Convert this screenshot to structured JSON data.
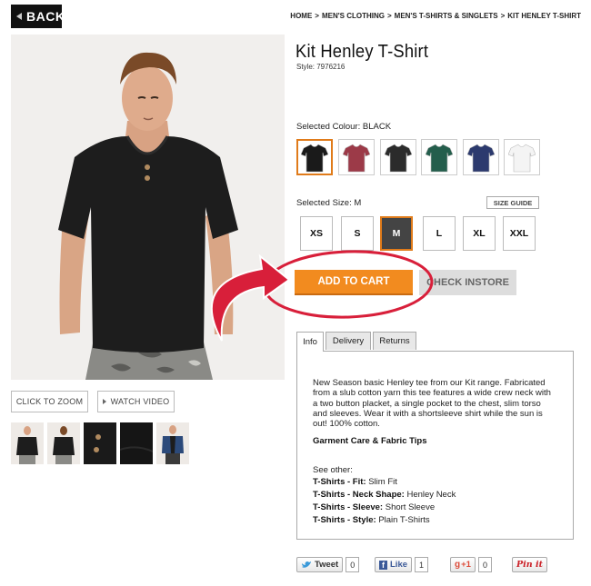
{
  "nav": {
    "back_label": "BACK"
  },
  "breadcrumb": [
    "HOME",
    "MEN'S CLOTHING",
    "MEN'S T-SHIRTS & SINGLETS",
    "KIT HENLEY T-SHIRT"
  ],
  "breadcrumb_separator": ">",
  "product": {
    "title": "Kit Henley T-Shirt",
    "style": "Style: 7976216"
  },
  "gallery": {
    "zoom_label": "CLICK TO ZOOM",
    "video_label": "WATCH VIDEO"
  },
  "colour": {
    "selected_label": "Selected Colour: BLACK",
    "swatches": [
      {
        "name": "black",
        "hex": "#1a1a1a"
      },
      {
        "name": "burgundy",
        "hex": "#9c3a48"
      },
      {
        "name": "charcoal",
        "hex": "#2b2b2b"
      },
      {
        "name": "green",
        "hex": "#245e4c"
      },
      {
        "name": "navy",
        "hex": "#2c3a6e"
      },
      {
        "name": "white",
        "hex": "#f4f4f4"
      }
    ]
  },
  "size": {
    "selected_label": "Selected Size: M",
    "guide_label": "SIZE GUIDE",
    "options": [
      "XS",
      "S",
      "M",
      "L",
      "XL",
      "XXL"
    ],
    "selected": "M"
  },
  "actions": {
    "add_to_cart": "ADD TO CART",
    "check_instore": "CHECK INSTORE"
  },
  "tabs": [
    "Info",
    "Delivery",
    "Returns"
  ],
  "info": {
    "description": "New Season basic Henley tee from our Kit range. Fabricated from a slub cotton yarn this tee features a wide crew neck with a two button placket, a single pocket to the chest, slim torso and sleeves. Wear it with a shortsleeve shirt while the sun is out! 100% cotton.",
    "care_title": "Garment Care & Fabric Tips",
    "see_other": "See other:",
    "attributes": [
      {
        "key": "T-Shirts - Fit:",
        "value": "Slim Fit"
      },
      {
        "key": "T-Shirts - Neck Shape:",
        "value": "Henley Neck"
      },
      {
        "key": "T-Shirts - Sleeve:",
        "value": "Short Sleeve"
      },
      {
        "key": "T-Shirts - Style:",
        "value": "Plain T-Shirts"
      }
    ]
  },
  "social": {
    "tweet_label": "Tweet",
    "tweet_count": "0",
    "like_label": "Like",
    "like_count": "1",
    "plus_label": "+1",
    "plus_count": "0",
    "pin_label": "Pin it"
  },
  "colors": {
    "accent": "#f28b1f",
    "selected_border": "#e07b1a"
  }
}
